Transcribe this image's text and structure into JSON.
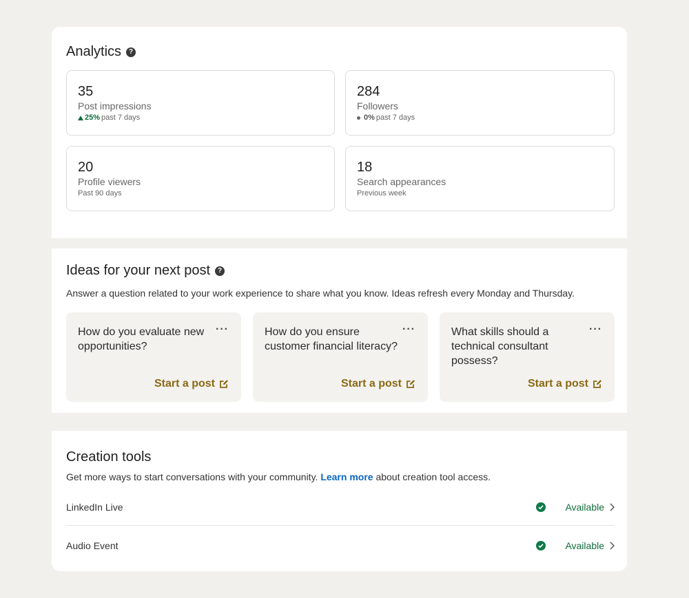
{
  "analytics": {
    "title": "Analytics",
    "help_icon": "question-circle-icon",
    "stats": [
      {
        "value": "35",
        "label": "Post impressions",
        "trend": "25%",
        "sub": "past 7 days"
      },
      {
        "value": "284",
        "label": "Followers",
        "trend": "0%",
        "sub": "past 7 days"
      },
      {
        "value": "20",
        "label": "Profile viewers",
        "sub": "Past 90 days"
      },
      {
        "value": "18",
        "label": "Search appearances",
        "sub": "Previous week"
      }
    ]
  },
  "ideas": {
    "title": "Ideas for your next post",
    "help_icon": "question-circle-icon",
    "subtitle": "Answer a question related to your work experience to share what you know. Ideas refresh every Monday and Thursday.",
    "cards": [
      {
        "question": "How do you evaluate new opportunities?",
        "action": "Start a post"
      },
      {
        "question": "How do you ensure customer financial literacy?",
        "action": "Start a post"
      },
      {
        "question": "What skills should a technical consultant possess?",
        "action": "Start a post"
      }
    ],
    "more_label": "···"
  },
  "tools": {
    "title": "Creation tools",
    "subtitle_before": "Get more ways to start conversations with your community. ",
    "link": "Learn more",
    "subtitle_after": " about creation tool access.",
    "items": [
      {
        "name": "LinkedIn Live",
        "status": "Available"
      },
      {
        "name": "Audio Event",
        "status": "Available"
      }
    ]
  },
  "colors": {
    "background": "#f1f0ed",
    "accent_gold": "#8b6914",
    "positive_green": "#0f6b3a",
    "link_blue": "#0a66c2"
  }
}
